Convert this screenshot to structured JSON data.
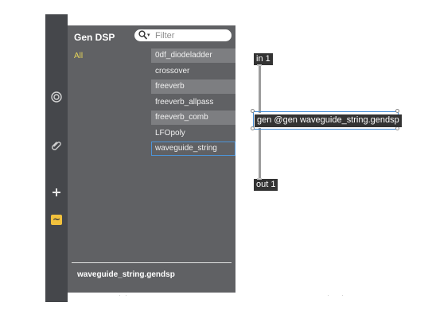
{
  "sidebar": {
    "icons": [
      "target-icon",
      "paperclip-icon",
      "plus-icon",
      "tilde-icon"
    ],
    "tilde_glyph": "~"
  },
  "panel": {
    "title": "Gen DSP",
    "search": {
      "placeholder": "Filter",
      "value": ""
    },
    "category": "All",
    "items": [
      "0df_diodeladder",
      "crossover",
      "freeverb",
      "freeverb_allpass",
      "freeverb_comb",
      "LFOpoly",
      "waveguide_string"
    ],
    "selected_item": "waveguide_string",
    "footer": "waveguide_string.gendsp"
  },
  "patcher": {
    "inlet_box": "in 1",
    "gen_box": "gen @gen waveguide_string.gendsp",
    "outlet_box": "out 1"
  },
  "colors": {
    "strip": "#45474b",
    "panel": "#606164",
    "accent_yellow": "#e6d55a",
    "selection_blue": "#4d94d8"
  }
}
